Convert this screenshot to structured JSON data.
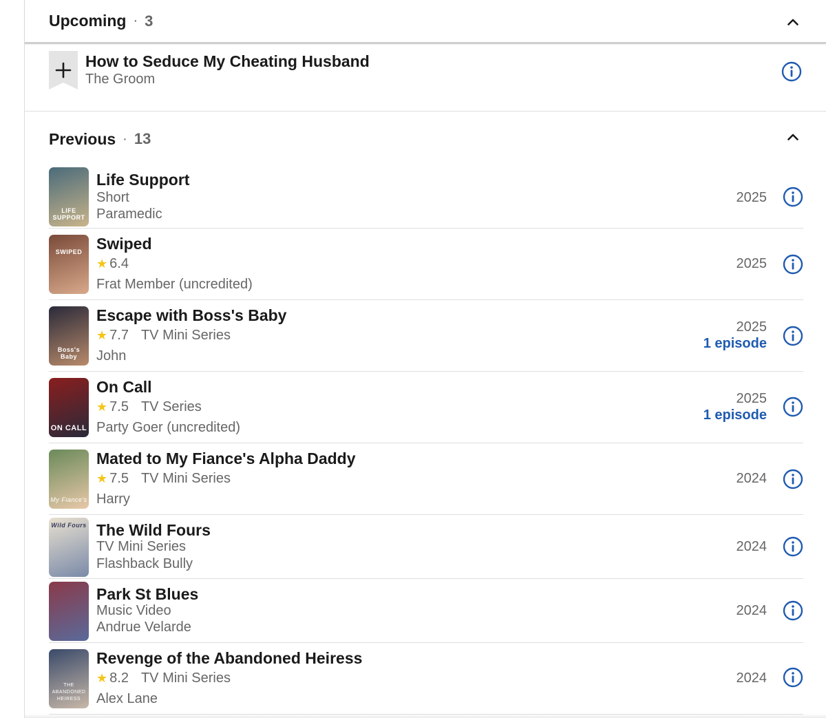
{
  "upcoming": {
    "title": "Upcoming",
    "separator": "·",
    "count": "3",
    "item": {
      "title": "How to Seduce My Cheating Husband",
      "role": "The Groom"
    }
  },
  "previous": {
    "title": "Previous",
    "separator": "·",
    "count": "13",
    "items": [
      {
        "title": "Life Support",
        "line1": "Short",
        "line2": "Paramedic",
        "year": "2025",
        "poster_text": "LIFE SUPPORT",
        "poster_colors": [
          "#4a6b7a",
          "#c9b48a"
        ]
      },
      {
        "title": "Swiped",
        "star": "★",
        "rating": "6.4",
        "kind": "",
        "line2": "Frat Member (uncredited)",
        "year": "2025",
        "poster_text": "SWIPED",
        "poster_colors": [
          "#7a4a3a",
          "#d8a98a"
        ]
      },
      {
        "title": "Escape with Boss's Baby",
        "star": "★",
        "rating": "7.7",
        "kind": "TV Mini Series",
        "line2": "John",
        "year": "2025",
        "episodes": "1 episode",
        "poster_text": "Boss's Baby",
        "poster_colors": [
          "#2a2a3a",
          "#b88a6a"
        ]
      },
      {
        "title": "On Call",
        "star": "★",
        "rating": "7.5",
        "kind": "TV Series",
        "line2": "Party Goer (uncredited)",
        "year": "2025",
        "episodes": "1 episode",
        "poster_text": "ON CALL",
        "poster_colors": [
          "#8a1e1e",
          "#2a2a3a"
        ]
      },
      {
        "title": "Mated to My Fiance's Alpha Daddy",
        "star": "★",
        "rating": "7.5",
        "kind": "TV Mini Series",
        "line2": "Harry",
        "year": "2024",
        "poster_text": "My Fiance's",
        "poster_colors": [
          "#6a8a5a",
          "#e8c8a8"
        ]
      },
      {
        "title": "The Wild Fours",
        "line1": "TV Mini Series",
        "line2": "Flashback Bully",
        "year": "2024",
        "poster_text": "Wild Fours",
        "poster_colors": [
          "#e8e0d0",
          "#7a8aa8"
        ]
      },
      {
        "title": "Park St Blues",
        "line1": "Music Video",
        "line2": "Andrue Velarde",
        "year": "2024",
        "poster_text": "",
        "poster_colors": [
          "#8a3a4a",
          "#5a6a9a"
        ]
      },
      {
        "title": "Revenge of the Abandoned Heiress",
        "star": "★",
        "rating": "8.2",
        "kind": "TV Mini Series",
        "line2": "Alex Lane",
        "year": "2024",
        "poster_text": "THE ABANDONED HEIRESS",
        "poster_colors": [
          "#3a4a6a",
          "#c8b8a8"
        ]
      }
    ]
  },
  "colors": {
    "link_blue": "#1f5bb0",
    "star_gold": "#f5c518",
    "muted_text": "#666666"
  },
  "icons": {
    "info": "info-circle-icon",
    "collapse": "chevron-up-icon",
    "add": "plus-icon"
  }
}
